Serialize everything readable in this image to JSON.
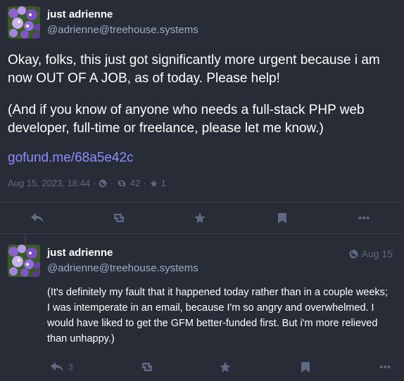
{
  "main_status": {
    "display_name": "just adrienne",
    "handle": "@adrienne@treehouse.systems",
    "paragraph1": "Okay, folks, this just got significantly more urgent because i am now OUT OF A JOB, as of today. Please help!",
    "paragraph2": "(And if you know of anyone who needs a full-stack PHP web developer, full-time or freelance, please let me know.)",
    "link_text": "gofund.me/68a5e42c",
    "timestamp": "Aug 15, 2023, 18:44",
    "boost_count": "42",
    "fav_count": "1",
    "separator": "·",
    "icons": [
      "globe-icon",
      "boost-icon",
      "star-icon"
    ]
  },
  "reply_status": {
    "display_name": "just adrienne",
    "handle": "@adrienne@treehouse.systems",
    "date": "Aug 15",
    "text": "(It's definitely my fault that it happened today rather than in a couple weeks; I was intemperate in an email, because I'm so angry and overwhelmed. I would have liked to get the GFM better-funded first. But i'm more relieved than unhappy.)",
    "reply_count": "3"
  },
  "colors": {
    "background": "#282c37",
    "muted": "#606984",
    "handle": "#9baec8",
    "link": "#8c8dff",
    "divider": "#393f4f"
  }
}
